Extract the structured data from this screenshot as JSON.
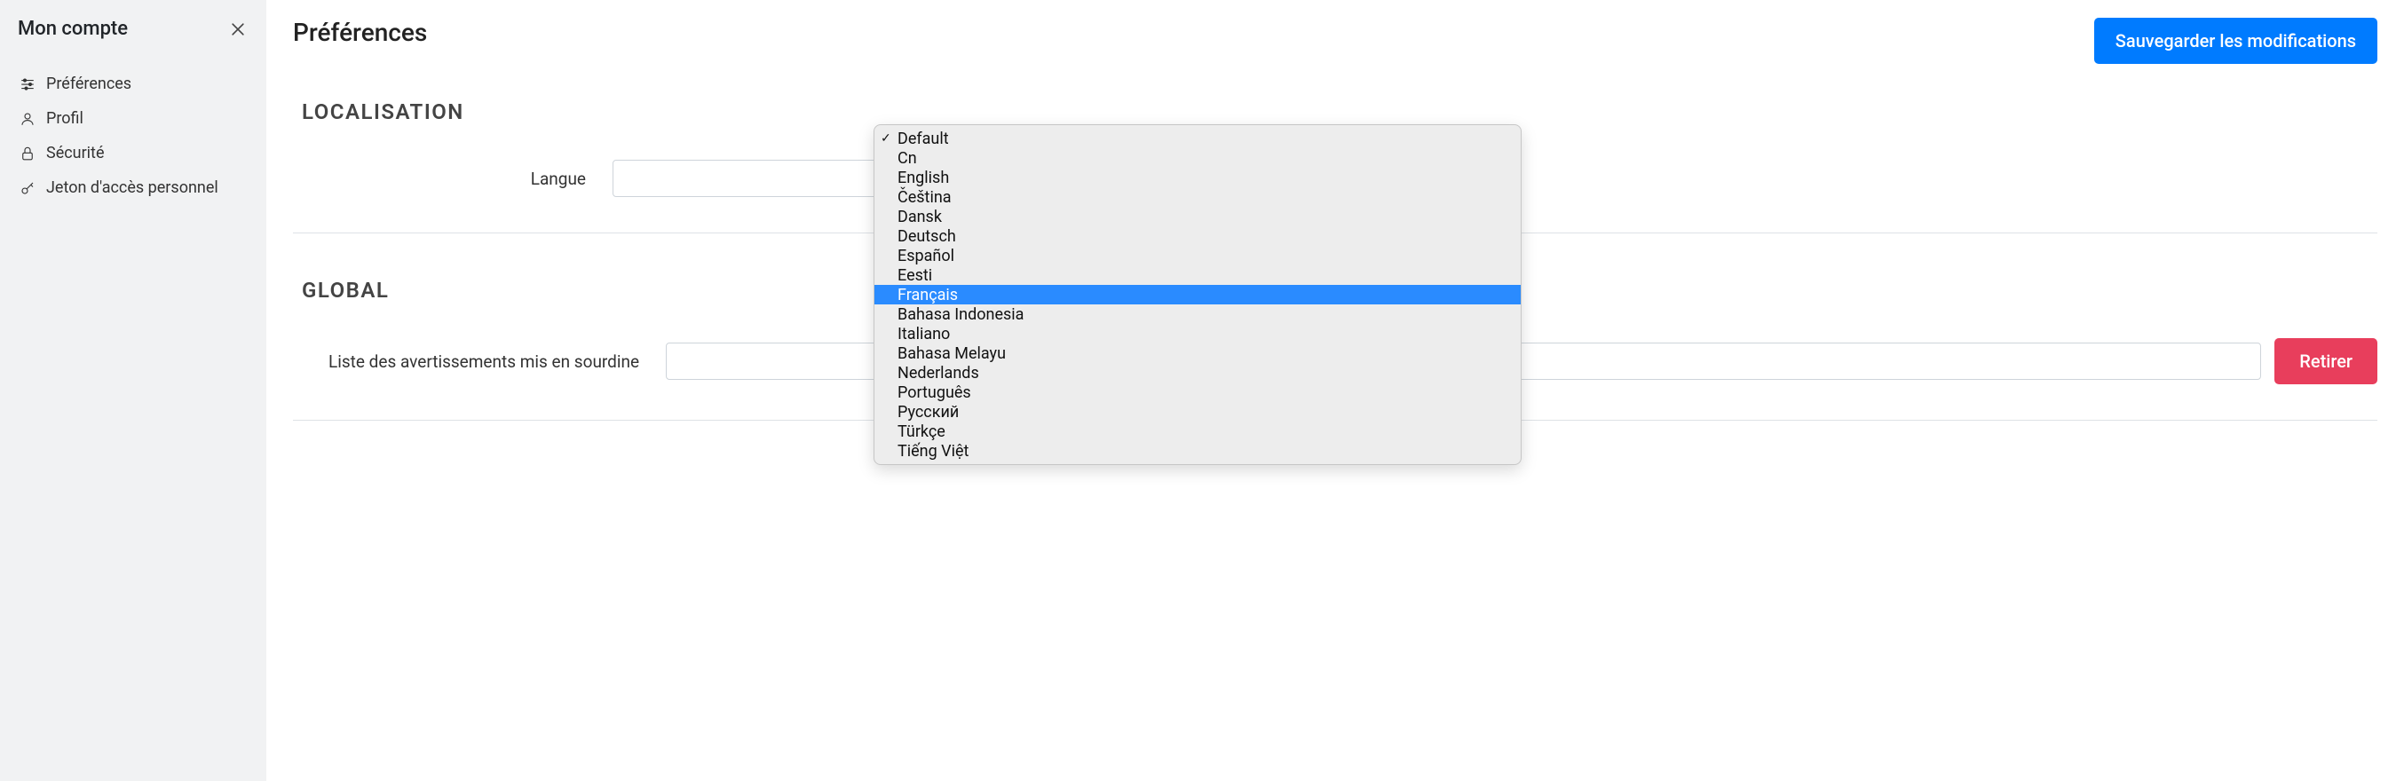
{
  "sidebar": {
    "title": "Mon compte",
    "items": [
      {
        "label": "Préférences",
        "icon": "sliders"
      },
      {
        "label": "Profil",
        "icon": "user"
      },
      {
        "label": "Sécurité",
        "icon": "lock"
      },
      {
        "label": "Jeton d'accès personnel",
        "icon": "key"
      }
    ]
  },
  "main": {
    "title": "Préférences",
    "save_label": "Sauvegarder les modifications"
  },
  "sections": {
    "localisation": {
      "title": "LOCALISATION",
      "language_label": "Langue"
    },
    "global": {
      "title": "GLOBAL",
      "muted_label": "Liste des avertissements mis en sourdine",
      "remove_label": "Retirer"
    }
  },
  "dropdown": {
    "checked_index": 0,
    "selected_index": 8,
    "options": [
      "Default",
      "Cn",
      "English",
      "Čeština",
      "Dansk",
      "Deutsch",
      "Español",
      "Eesti",
      "Français",
      "Bahasa Indonesia",
      "Italiano",
      "Bahasa Melayu",
      "Nederlands",
      "Português",
      "Русский",
      "Türkçe",
      "Tiếng Việt"
    ]
  }
}
